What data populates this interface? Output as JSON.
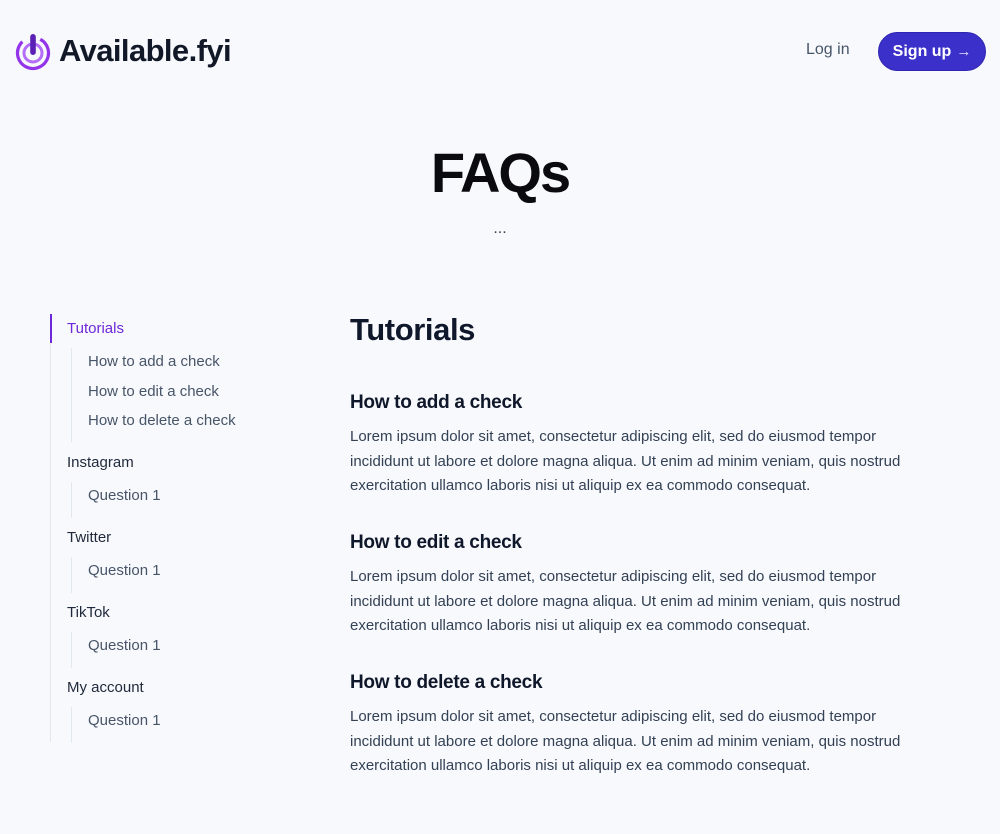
{
  "header": {
    "brand": "Available.fyi",
    "login": "Log in",
    "signup": "Sign up",
    "signup_icon": "arrow-right-icon",
    "brand_color": "#9333ea",
    "accent_color": "#3b30c9"
  },
  "hero": {
    "title": "FAQs",
    "subtitle": "..."
  },
  "sidebar": {
    "groups": [
      {
        "label": "Tutorials",
        "active": true,
        "items": [
          "How to add a check",
          "How to edit a check",
          "How to delete a check"
        ]
      },
      {
        "label": "Instagram",
        "items": [
          "Question 1"
        ]
      },
      {
        "label": "Twitter",
        "items": [
          "Question 1"
        ]
      },
      {
        "label": "TikTok",
        "items": [
          "Question 1"
        ]
      },
      {
        "label": "My account",
        "items": [
          "Question 1"
        ]
      }
    ]
  },
  "content": {
    "section_title": "Tutorials",
    "faqs": [
      {
        "title": "How to add a check",
        "body": "Lorem ipsum dolor sit amet, consectetur adipiscing elit, sed do eiusmod tempor incididunt ut labore et dolore magna aliqua. Ut enim ad minim veniam, quis nostrud exercitation ullamco laboris nisi ut aliquip ex ea commodo consequat."
      },
      {
        "title": "How to edit a check",
        "body": "Lorem ipsum dolor sit amet, consectetur adipiscing elit, sed do eiusmod tempor incididunt ut labore et dolore magna aliqua. Ut enim ad minim veniam, quis nostrud exercitation ullamco laboris nisi ut aliquip ex ea commodo consequat."
      },
      {
        "title": "How to delete a check",
        "body": "Lorem ipsum dolor sit amet, consectetur adipiscing elit, sed do eiusmod tempor incididunt ut labore et dolore magna aliqua. Ut enim ad minim veniam, quis nostrud exercitation ullamco laboris nisi ut aliquip ex ea commodo consequat."
      }
    ]
  }
}
